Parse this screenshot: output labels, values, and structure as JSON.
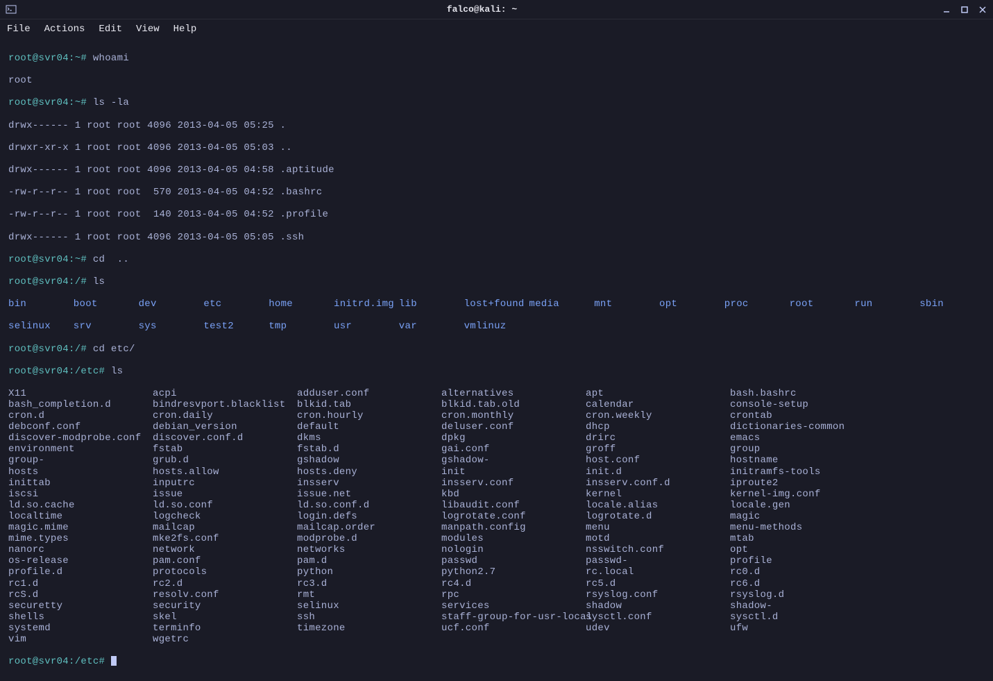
{
  "window": {
    "title": "falco@kali: ~"
  },
  "menu": {
    "file": "File",
    "actions": "Actions",
    "edit": "Edit",
    "view": "View",
    "help": "Help"
  },
  "prompts": {
    "p1": "root@svr04:~# ",
    "p2": "root@svr04:~# ",
    "p3": "root@svr04:~# ",
    "p4": "root@svr04:/# ",
    "p5": "root@svr04:/# ",
    "p6": "root@svr04:/etc# ",
    "p7": "root@svr04:/etc# "
  },
  "commands": {
    "whoami": "whoami",
    "lsla": "ls -la",
    "cdup": "cd  ..",
    "ls": "ls",
    "cdetc": "cd etc/",
    "ls2": "ls"
  },
  "whoami_output": "root",
  "lsla_lines": [
    "drwx------ 1 root root 4096 2013-04-05 05:25 .",
    "drwxr-xr-x 1 root root 4096 2013-04-05 05:03 ..",
    "drwx------ 1 root root 4096 2013-04-05 04:58 .aptitude",
    "-rw-r--r-- 1 root root  570 2013-04-05 04:52 .bashrc",
    "-rw-r--r-- 1 root root  140 2013-04-05 04:52 .profile",
    "drwx------ 1 root root 4096 2013-04-05 05:05 .ssh"
  ],
  "root_dirs_row1": [
    "bin",
    "boot",
    "dev",
    "etc",
    "home",
    "initrd.img",
    "lib",
    "lost+found",
    "media",
    "mnt",
    "opt",
    "proc",
    "root",
    "run",
    "sbin"
  ],
  "root_dirs_row2": [
    "selinux",
    "srv",
    "sys",
    "test2",
    "tmp",
    "usr",
    "var",
    "vmlinuz"
  ],
  "etc_files": [
    [
      "X11",
      "acpi",
      "adduser.conf",
      "alternatives",
      "apt",
      "bash.bashrc"
    ],
    [
      "bash_completion.d",
      "bindresvport.blacklist",
      "blkid.tab",
      "blkid.tab.old",
      "calendar",
      "console-setup"
    ],
    [
      "cron.d",
      "cron.daily",
      "cron.hourly",
      "cron.monthly",
      "cron.weekly",
      "crontab"
    ],
    [
      "debconf.conf",
      "debian_version",
      "default",
      "deluser.conf",
      "dhcp",
      "dictionaries-common"
    ],
    [
      "discover-modprobe.conf",
      "discover.conf.d",
      "dkms",
      "dpkg",
      "drirc",
      "emacs"
    ],
    [
      "environment",
      "fstab",
      "fstab.d",
      "gai.conf",
      "groff",
      "group"
    ],
    [
      "group-",
      "grub.d",
      "gshadow",
      "gshadow-",
      "host.conf",
      "hostname"
    ],
    [
      "hosts",
      "hosts.allow",
      "hosts.deny",
      "init",
      "init.d",
      "initramfs-tools"
    ],
    [
      "inittab",
      "inputrc",
      "insserv",
      "insserv.conf",
      "insserv.conf.d",
      "iproute2"
    ],
    [
      "iscsi",
      "issue",
      "issue.net",
      "kbd",
      "kernel",
      "kernel-img.conf"
    ],
    [
      "ld.so.cache",
      "ld.so.conf",
      "ld.so.conf.d",
      "libaudit.conf",
      "locale.alias",
      "locale.gen"
    ],
    [
      "localtime",
      "logcheck",
      "login.defs",
      "logrotate.conf",
      "logrotate.d",
      "magic"
    ],
    [
      "magic.mime",
      "mailcap",
      "mailcap.order",
      "manpath.config",
      "menu",
      "menu-methods"
    ],
    [
      "mime.types",
      "mke2fs.conf",
      "modprobe.d",
      "modules",
      "motd",
      "mtab"
    ],
    [
      "nanorc",
      "network",
      "networks",
      "nologin",
      "nsswitch.conf",
      "opt"
    ],
    [
      "os-release",
      "pam.conf",
      "pam.d",
      "passwd",
      "passwd-",
      "profile"
    ],
    [
      "profile.d",
      "protocols",
      "python",
      "python2.7",
      "rc.local",
      "rc0.d"
    ],
    [
      "rc1.d",
      "rc2.d",
      "rc3.d",
      "rc4.d",
      "rc5.d",
      "rc6.d"
    ],
    [
      "rcS.d",
      "resolv.conf",
      "rmt",
      "rpc",
      "rsyslog.conf",
      "rsyslog.d"
    ],
    [
      "securetty",
      "security",
      "selinux",
      "services",
      "shadow",
      "shadow-"
    ],
    [
      "shells",
      "skel",
      "ssh",
      "staff-group-for-usr-local",
      "sysctl.conf",
      "sysctl.d"
    ],
    [
      "systemd",
      "terminfo",
      "timezone",
      "ucf.conf",
      "udev",
      "ufw"
    ],
    [
      "vim",
      "wgetrc",
      "",
      "",
      "",
      ""
    ]
  ]
}
